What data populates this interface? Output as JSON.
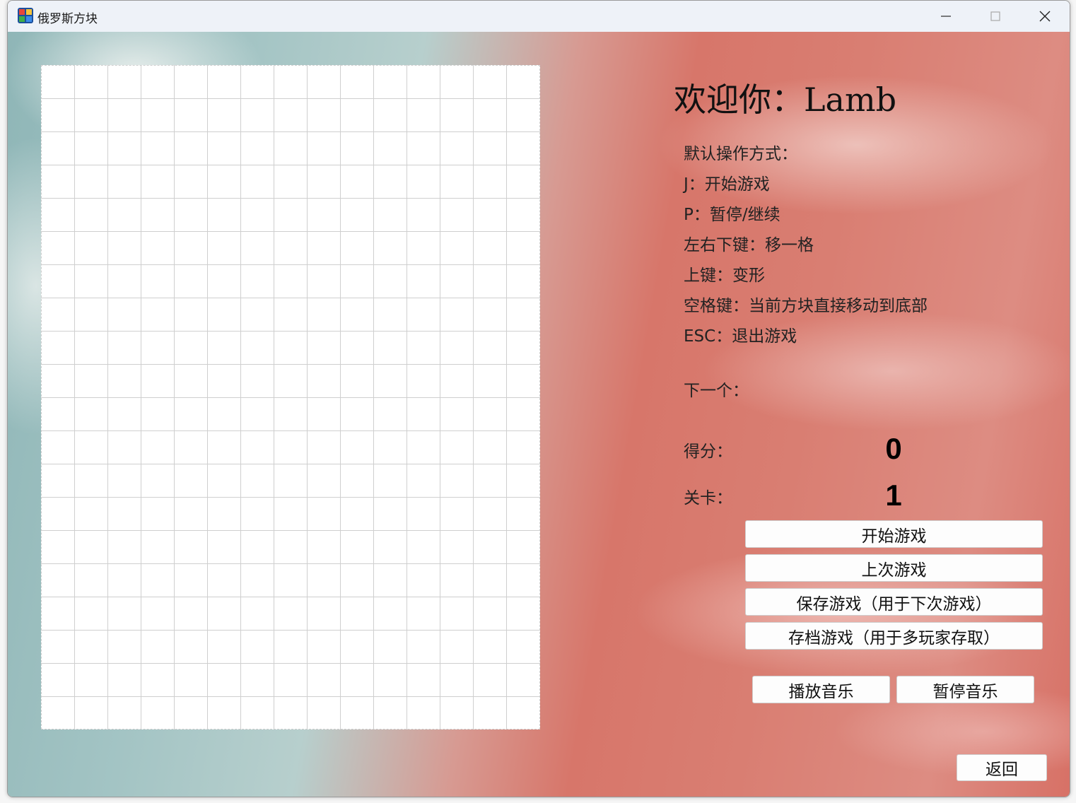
{
  "window": {
    "title": "俄罗斯方块",
    "icon": "tetris-app-icon",
    "controls": {
      "minimize_icon": "minimize-icon",
      "maximize_icon": "maximize-icon",
      "close_icon": "close-icon"
    }
  },
  "welcome": "欢迎你：Lamb",
  "controls_help": {
    "heading": "默认操作方式：",
    "lines": [
      "J：开始游戏",
      "P：暂停/继续",
      "左右下键：移一格",
      "上键：变形",
      "空格键：当前方块直接移动到底部",
      "ESC：退出游戏"
    ]
  },
  "next_label": "下一个：",
  "score": {
    "label": "得分：",
    "value": "0"
  },
  "level": {
    "label": "关卡：",
    "value": "1"
  },
  "buttons": {
    "start": "开始游戏",
    "last_game": "上次游戏",
    "save_game": "保存游戏（用于下次游戏）",
    "archive_game": "存档游戏（用于多玩家存取）",
    "play_music": "播放音乐",
    "pause_music": "暂停音乐",
    "back": "返回"
  },
  "board": {
    "columns": 15,
    "rows": 20
  },
  "colors": {
    "accent_red": "#d7766a",
    "accent_teal": "#8fb6b7",
    "grid_line": "#cfcfcf"
  }
}
